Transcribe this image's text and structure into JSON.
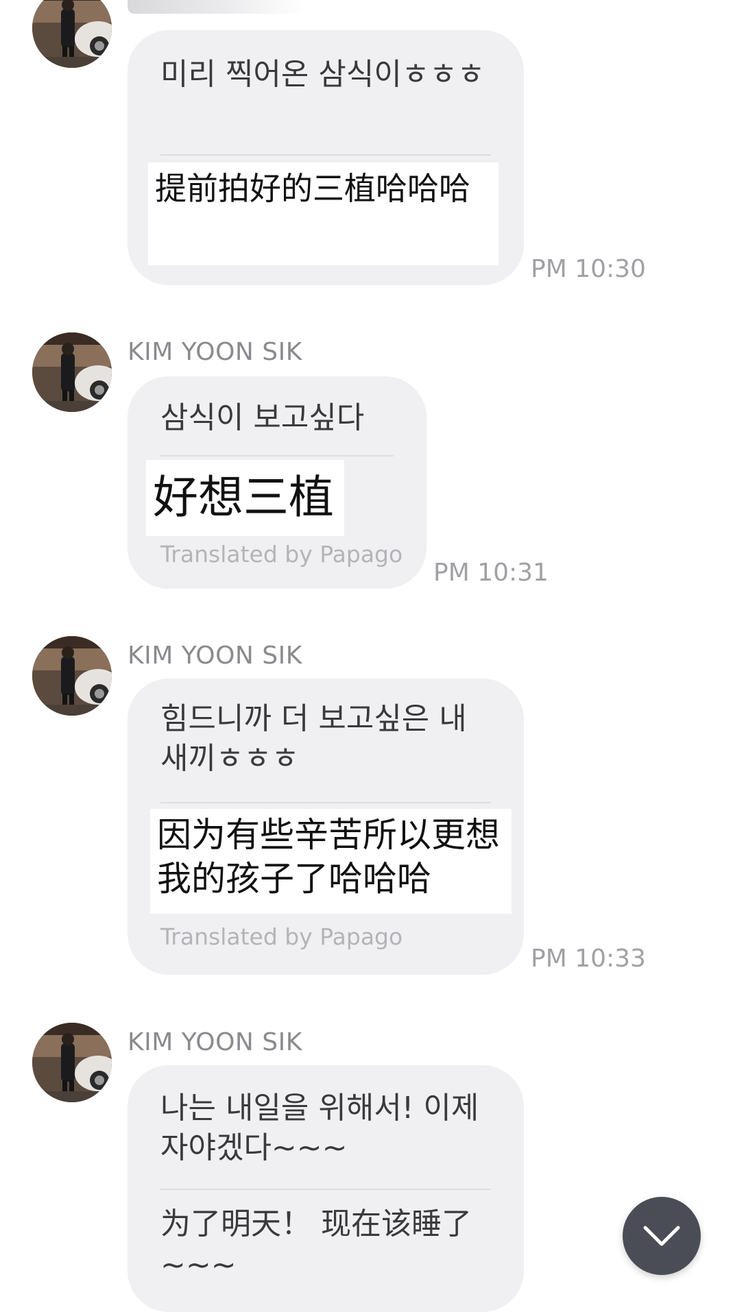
{
  "messages": [
    {
      "sender": "",
      "original": "미리 찍어온 삼식이ㅎㅎㅎ",
      "translation": "提前拍好的三植哈哈哈",
      "credit": "",
      "time": "PM 10:30"
    },
    {
      "sender": "KIM YOON SIK",
      "original": "삼식이 보고싶다",
      "translation": "好想三植",
      "credit": "Translated by Papago",
      "time": "PM 10:31"
    },
    {
      "sender": "KIM YOON SIK",
      "original": "힘드니까 더 보고싶은 내 새끼ㅎㅎㅎ",
      "translation": "因为有些辛苦所以更想我的孩子了哈哈哈",
      "credit": "Translated by Papago",
      "time": "PM 10:33"
    },
    {
      "sender": "KIM YOON SIK",
      "original": "나는 내일을 위해서! 이제 자야겠다~~~",
      "translation": "为了明天！ 现在该睡了~~~",
      "credit": "",
      "time": ""
    }
  ],
  "icons": {
    "avatar": "profile-photo",
    "scroll_down": "chevron-down-icon"
  },
  "colors": {
    "bubble": "#f0f0f3",
    "translation_box": "#ffffff",
    "fab": "#4b4d56",
    "meta_text": "#a0a0a5"
  }
}
